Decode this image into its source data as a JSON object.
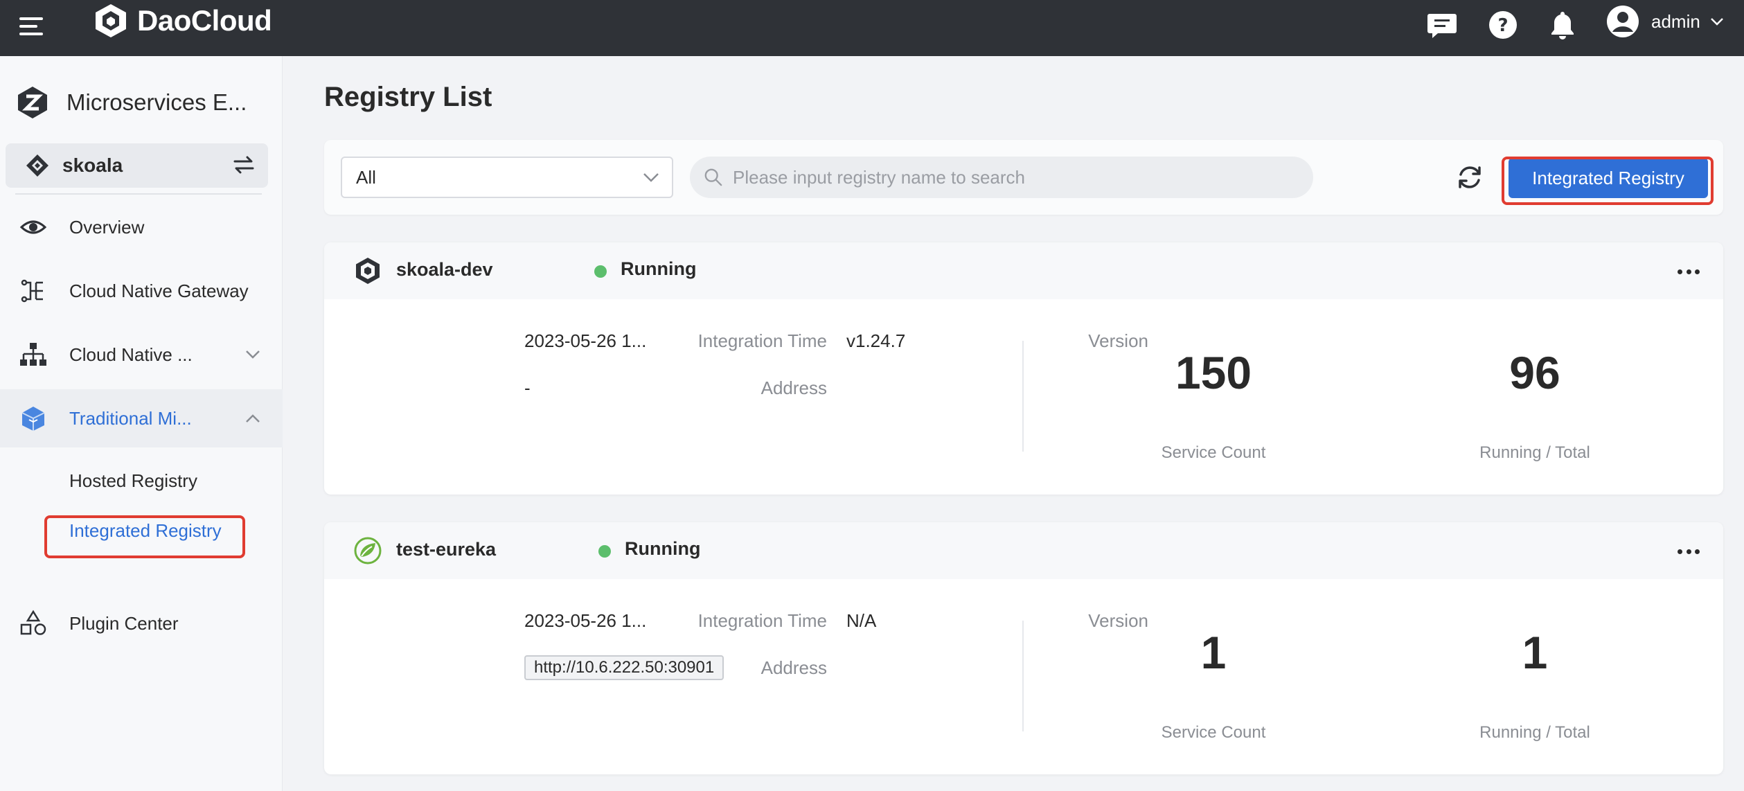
{
  "topbar": {
    "brand": "DaoCloud",
    "user": "admin"
  },
  "sidebar": {
    "module_title": "Microservices E...",
    "workspace": "skoala",
    "nav": [
      {
        "label": "Overview",
        "icon": "eye-icon"
      },
      {
        "label": "Cloud Native Gateway",
        "icon": "gateway-icon"
      },
      {
        "label": "Cloud Native ...",
        "icon": "hierarchy-icon"
      },
      {
        "label": "Traditional Mi...",
        "icon": "cube-icon"
      }
    ],
    "sub_items": [
      {
        "label": "Hosted Registry"
      },
      {
        "label": "Integrated Registry"
      }
    ],
    "plugin_center": "Plugin Center"
  },
  "main": {
    "title": "Registry List",
    "filter_value": "All",
    "search_placeholder": "Please input registry name to search",
    "integrate_button": "Integrated Registry",
    "labels": {
      "integration_time": "Integration Time",
      "version": "Version",
      "address": "Address",
      "service_count": "Service Count",
      "running_total": "Running / Total"
    },
    "registries": [
      {
        "name": "skoala-dev",
        "status": "Running",
        "integration_time": "2023-05-26 1...",
        "version": "v1.24.7",
        "address": "-",
        "service_count": "150",
        "running_total": "96"
      },
      {
        "name": "test-eureka",
        "status": "Running",
        "integration_time": "2023-05-26 1...",
        "version": "N/A",
        "address": "http://10.6.222.50:30901",
        "service_count": "1",
        "running_total": "1"
      }
    ]
  }
}
